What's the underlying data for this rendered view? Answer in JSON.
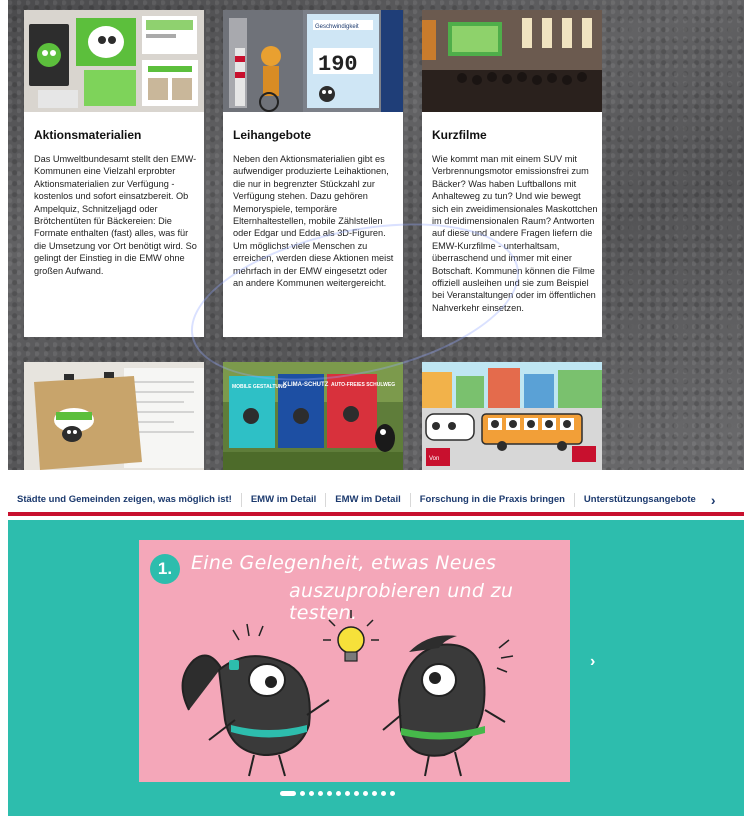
{
  "cards": [
    {
      "title": "Aktionsmaterialien",
      "text": "Das Umweltbundesamt stellt den EMW-Kommunen eine Vielzahl erprobter Aktionsmaterialien zur Verfügung - kostenlos und sofort einsatzbereit. Ob Ampelquiz, Schnitzeljagd oder Brötchentüten für Bäckereien: Die Formate enthalten (fast) alles, was für die Umsetzung vor Ort benötigt wird. So gelingt der Einstieg in die EMW ohne großen Aufwand."
    },
    {
      "title": "Leihangebote",
      "text": "Neben den Aktionsmaterialien gibt es aufwendiger produzierte Leihaktionen, die nur in begrenzter Stückzahl zur Verfügung stehen. Dazu gehören Memoryspiele, temporäre Elternhaltestellen, mobile Zählstellen oder Edgar und Edda als 3D-Figuren. Um möglichst viele Menschen zu erreichen, werden diese Aktionen meist mehrfach in der EMW eingesetzt oder an andere Kommunen weitergereicht."
    },
    {
      "title": "Kurzfilme",
      "text": "Wie kommt man mit einem SUV mit Verbrennungsmotor emissionsfrei zum Bäcker? Was haben Luftballons mit Anhalteweg zu tun? Und wie bewegt sich ein zweidimensionales Maskottchen im dreidimensionalen Raum? Antworten auf diese und andere Fragen liefern die EMW-Kurzfilme - unterhaltsam, überraschend und immer mit einer Botschaft. Kommunen können die Filme offiziell ausleihen und sie zum Beispiel bei Veranstaltungen oder im öffentlichen Nahverkehr einsetzen."
    }
  ],
  "photos": {
    "card2_counter": "190",
    "card2_sign": "Geschwindigkeit",
    "poster_texts": [
      "MOBILE GESTALTUNG",
      "KLIMA-SCHUTZ",
      "AUTO-FREIES SCHULWEG"
    ],
    "bus_sign": "Von"
  },
  "tabs": [
    "Städte und Gemeinden zeigen, was möglich ist!",
    "EMW im Detail",
    "EMW im Detail",
    "Forschung in die Praxis bringen",
    "Unterstützungsangebote"
  ],
  "tabnav_next": "›",
  "carousel": {
    "number": "1.",
    "headline_line1": "Eine Gelegenheit, etwas Neues",
    "headline_line2": "auszuprobieren und zu testen.",
    "next": "›",
    "dot_count": 12,
    "active_dot": 1
  },
  "colors": {
    "accent_red": "#c8102e",
    "teal": "#2dbdad",
    "pink": "#f4a7b9",
    "nav_text": "#1c3a6e"
  }
}
